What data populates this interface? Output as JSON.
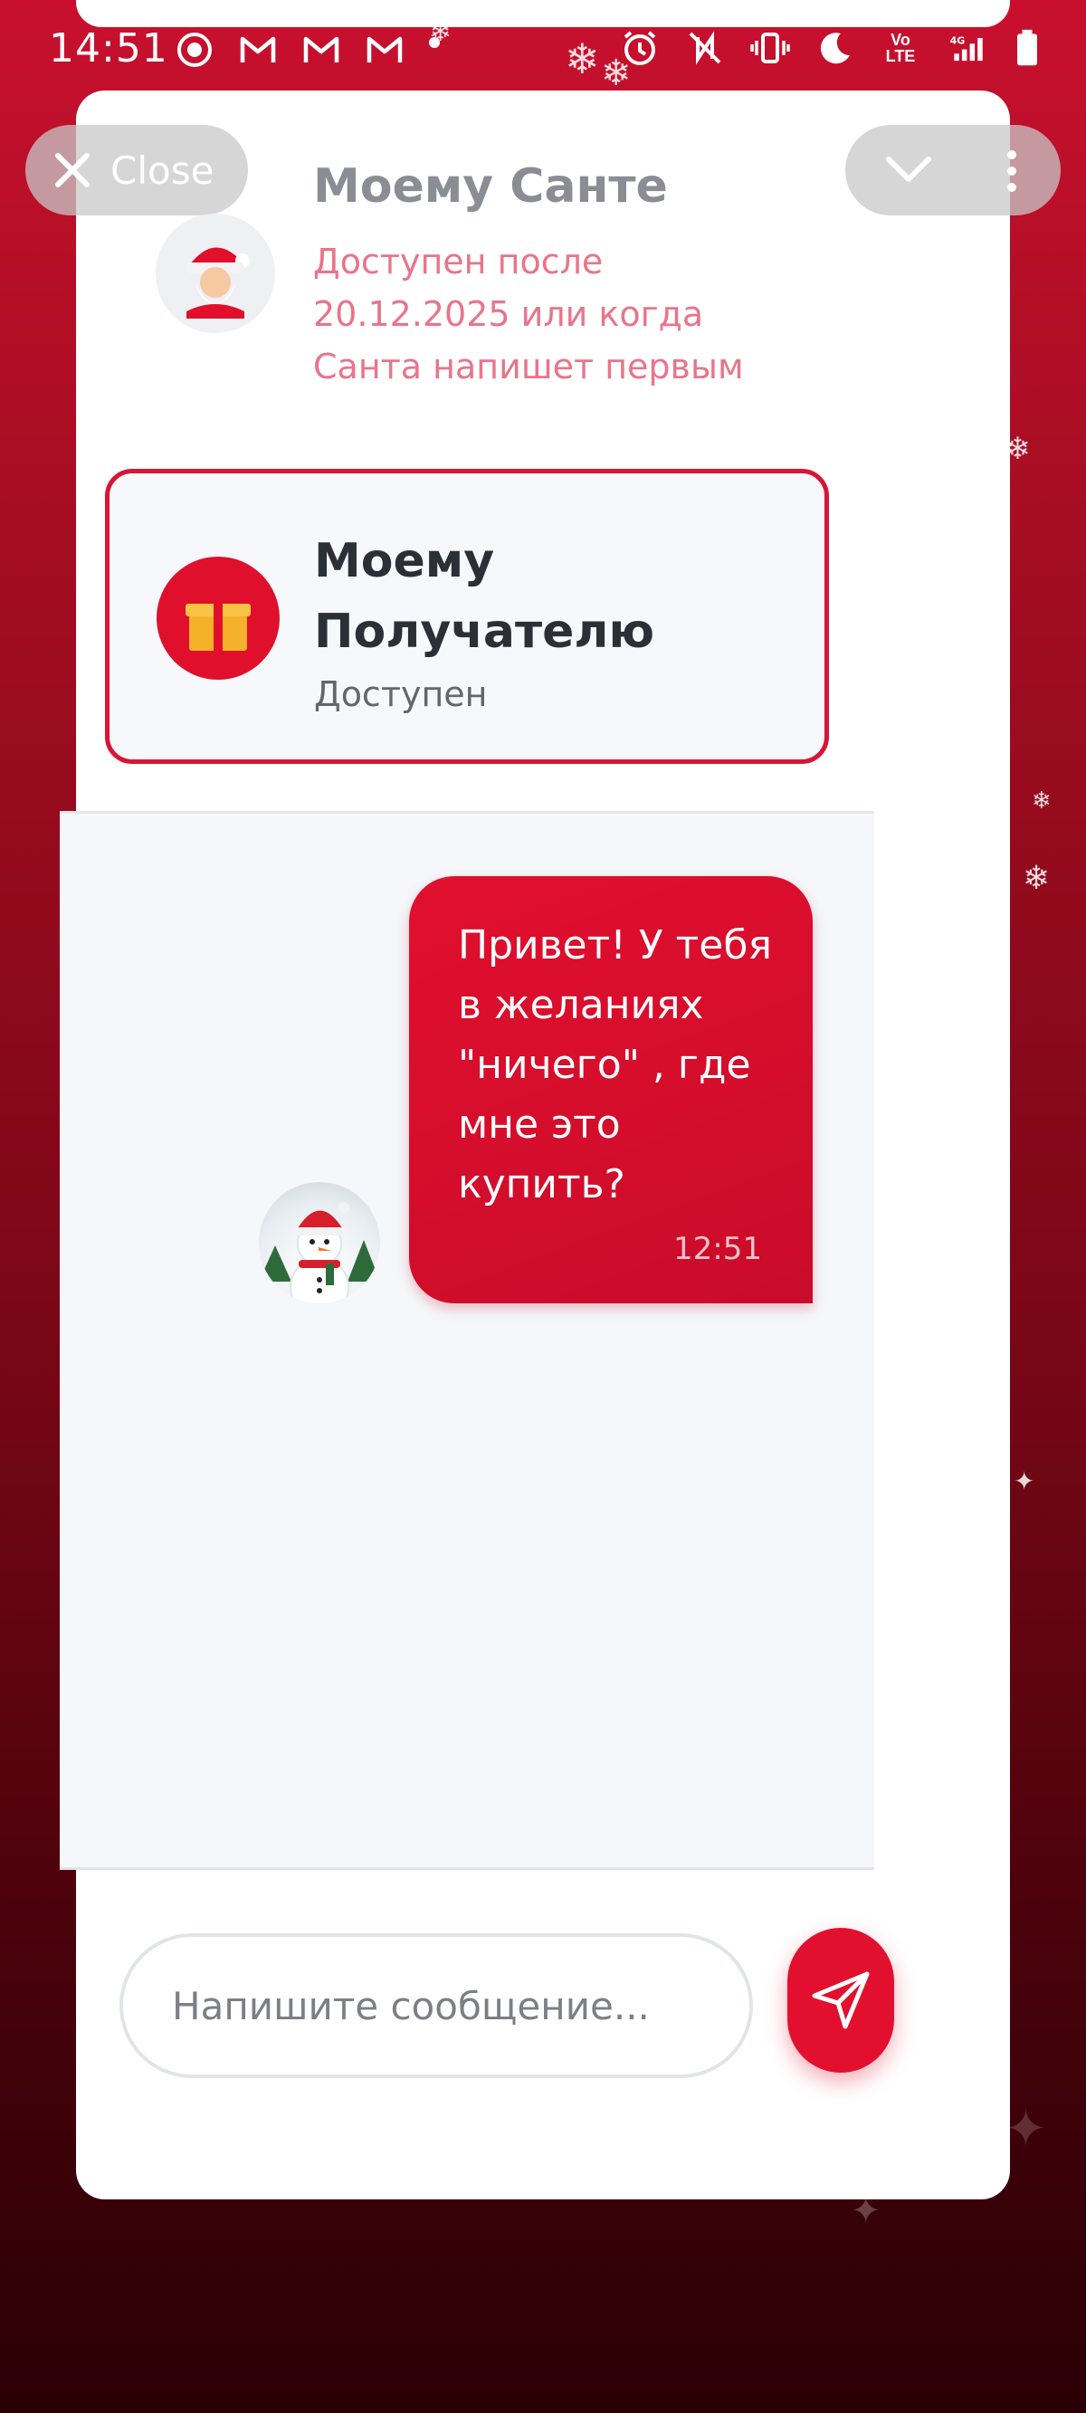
{
  "status_bar": {
    "time": "14:51",
    "left_icons": [
      "record-icon",
      "gmail-icon",
      "gmail-icon",
      "gmail-icon",
      "dot-icon"
    ],
    "right_icons": [
      "alarm-icon",
      "nfc-off-icon",
      "vibrate-icon",
      "moon-icon",
      "volte-icon",
      "signal-4g-icon",
      "battery-icon"
    ],
    "volte_label": "Vo LTE",
    "network_label": "4G"
  },
  "header": {
    "close_label": "Close"
  },
  "santa_chat": {
    "title": "Моему Санте",
    "subtitle": "Доступен после 20.12.2025 или когда Санта напишет первым"
  },
  "recipient_chat": {
    "title": "Моему Получателю",
    "status": "Доступен"
  },
  "messages": [
    {
      "text": "Привет! У тебя\nв желаниях\n\"ничего\" , где\nмне это\nкупить?",
      "time": "12:51"
    }
  ],
  "composer": {
    "placeholder": "Напишите сообщение..."
  },
  "colors": {
    "accent": "#e2102e",
    "santa_subtitle": "#e8758a",
    "background_top": "#c8102e",
    "background_bottom": "#2a0005"
  }
}
